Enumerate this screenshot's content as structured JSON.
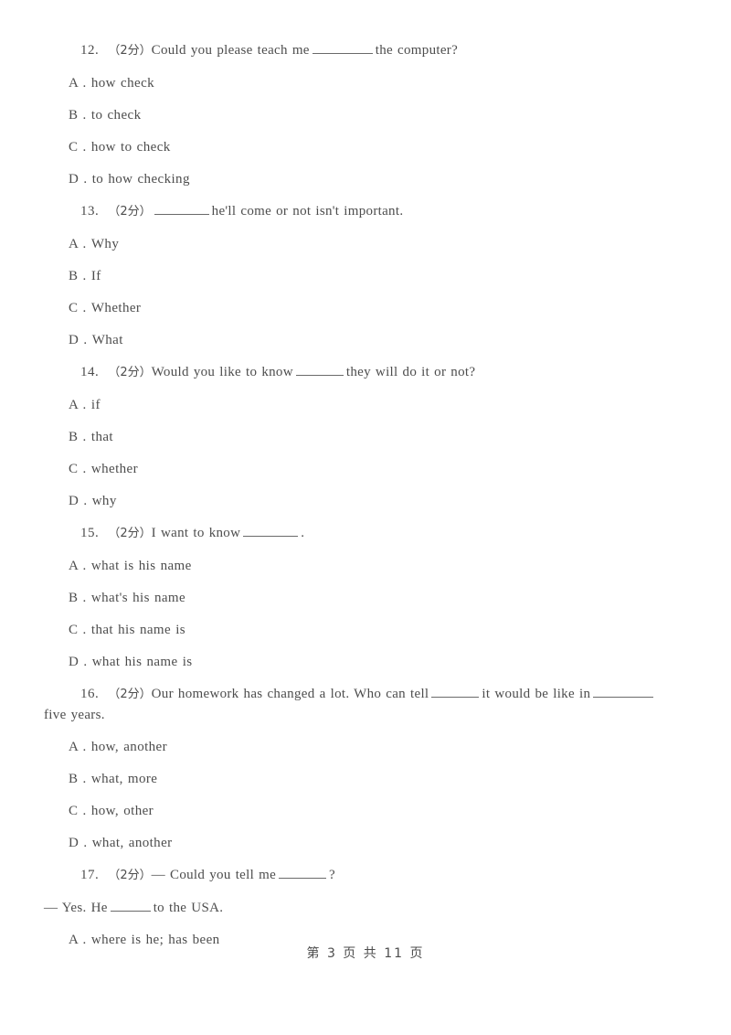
{
  "document": {
    "type": "exam-paper",
    "language": "en-zh",
    "marks_label": "（2分）"
  },
  "questions": [
    {
      "number": "12.",
      "marks": "（2分）",
      "stem_before": "Could you please teach me",
      "blank": "w-xl",
      "stem_after": "the computer?",
      "options": [
        {
          "letter": "A .",
          "text": "how check"
        },
        {
          "letter": "B .",
          "text": "to check"
        },
        {
          "letter": "C .",
          "text": "how to check"
        },
        {
          "letter": "D .",
          "text": "to how checking"
        }
      ]
    },
    {
      "number": "13.",
      "marks": "（2分）",
      "stem_before": "",
      "blank": "w-l",
      "stem_after": "he'll come or not isn't important.",
      "options": [
        {
          "letter": "A .",
          "text": "Why"
        },
        {
          "letter": "B .",
          "text": "If"
        },
        {
          "letter": "C .",
          "text": "Whether"
        },
        {
          "letter": "D .",
          "text": "What"
        }
      ]
    },
    {
      "number": "14.",
      "marks": "（2分）",
      "stem_before": "Would you like to know",
      "blank": "w-m",
      "stem_after": "they will do it or not?",
      "options": [
        {
          "letter": "A .",
          "text": "if"
        },
        {
          "letter": "B .",
          "text": "that"
        },
        {
          "letter": "C .",
          "text": "whether"
        },
        {
          "letter": "D .",
          "text": "why"
        }
      ]
    },
    {
      "number": "15.",
      "marks": "（2分）",
      "stem_before": "I want to know",
      "blank": "w-l",
      "stem_after": ".",
      "options": [
        {
          "letter": "A .",
          "text": "what is his name"
        },
        {
          "letter": "B .",
          "text": "what's his name"
        },
        {
          "letter": "C .",
          "text": "that his name is"
        },
        {
          "letter": "D .",
          "text": "what his name is"
        }
      ]
    },
    {
      "number": "16.",
      "marks": "（2分）",
      "stem_before": "Our homework has changed a lot. Who can tell",
      "blank": "w-m",
      "stem_middle": "it would be like in",
      "blank2": "w-xl",
      "wrap_line": "five years.",
      "options": [
        {
          "letter": "A .",
          "text": "how, another"
        },
        {
          "letter": "B .",
          "text": "what, more"
        },
        {
          "letter": "C .",
          "text": "how, other"
        },
        {
          "letter": "D .",
          "text": "what, another"
        }
      ]
    },
    {
      "number": "17.",
      "marks": "（2分）",
      "dash": "—",
      "stem_before": "Could you tell me",
      "blank": "w-m",
      "stem_after": "?",
      "answer_line_before": "— Yes. He",
      "answer_blank": "w-s",
      "answer_line_after": "to the USA.",
      "options": [
        {
          "letter": "A .",
          "text": "where is he; has been"
        }
      ]
    }
  ],
  "footer": {
    "text": "第 3 页 共 11 页"
  }
}
